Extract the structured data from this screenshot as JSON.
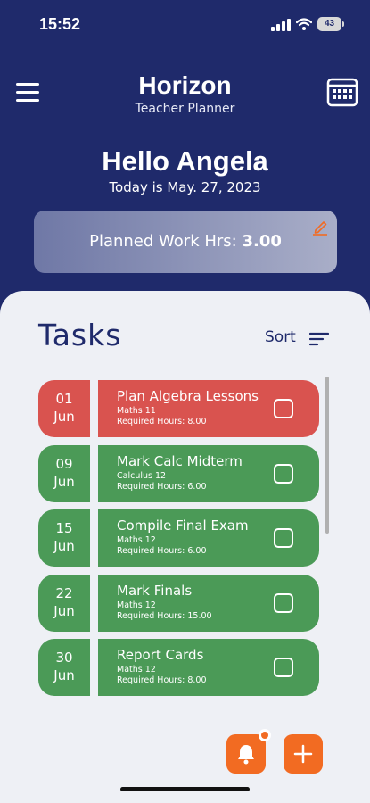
{
  "status_bar": {
    "time": "15:52",
    "battery": "43"
  },
  "header": {
    "title": "Horizon",
    "subtitle": "Teacher Planner",
    "greeting": "Hello Angela",
    "today": "Today is May. 27, 2023",
    "planned_label": "Planned Work Hrs:",
    "planned_value": "3.00"
  },
  "tasks": {
    "title": "Tasks",
    "sort_label": "Sort",
    "items": [
      {
        "day": "01",
        "month": "Jun",
        "name": "Plan Algebra Lessons",
        "course": "Maths 11",
        "hours": "Required Hours: 8.00",
        "status": "overdue"
      },
      {
        "day": "09",
        "month": "Jun",
        "name": "Mark Calc Midterm",
        "course": "Calculus 12",
        "hours": "Required Hours: 6.00",
        "status": "upcoming"
      },
      {
        "day": "15",
        "month": "Jun",
        "name": "Compile Final Exam",
        "course": "Maths 12",
        "hours": "Required Hours: 6.00",
        "status": "upcoming"
      },
      {
        "day": "22",
        "month": "Jun",
        "name": "Mark Finals",
        "course": "Maths 12",
        "hours": "Required Hours: 15.00",
        "status": "upcoming"
      },
      {
        "day": "30",
        "month": "Jun",
        "name": "Report Cards",
        "course": "Maths 12",
        "hours": "Required Hours: 8.00",
        "status": "upcoming"
      }
    ]
  },
  "colors": {
    "primary": "#1f2a6b",
    "overdue": "#d9534f",
    "upcoming": "#4b9a57",
    "accent": "#f26b22",
    "background": "#eef0f5"
  },
  "icons": [
    "menu-icon",
    "calendar-icon",
    "edit-icon",
    "sort-icon",
    "bell-icon",
    "add-icon",
    "signal-icon",
    "wifi-icon",
    "battery-icon"
  ]
}
